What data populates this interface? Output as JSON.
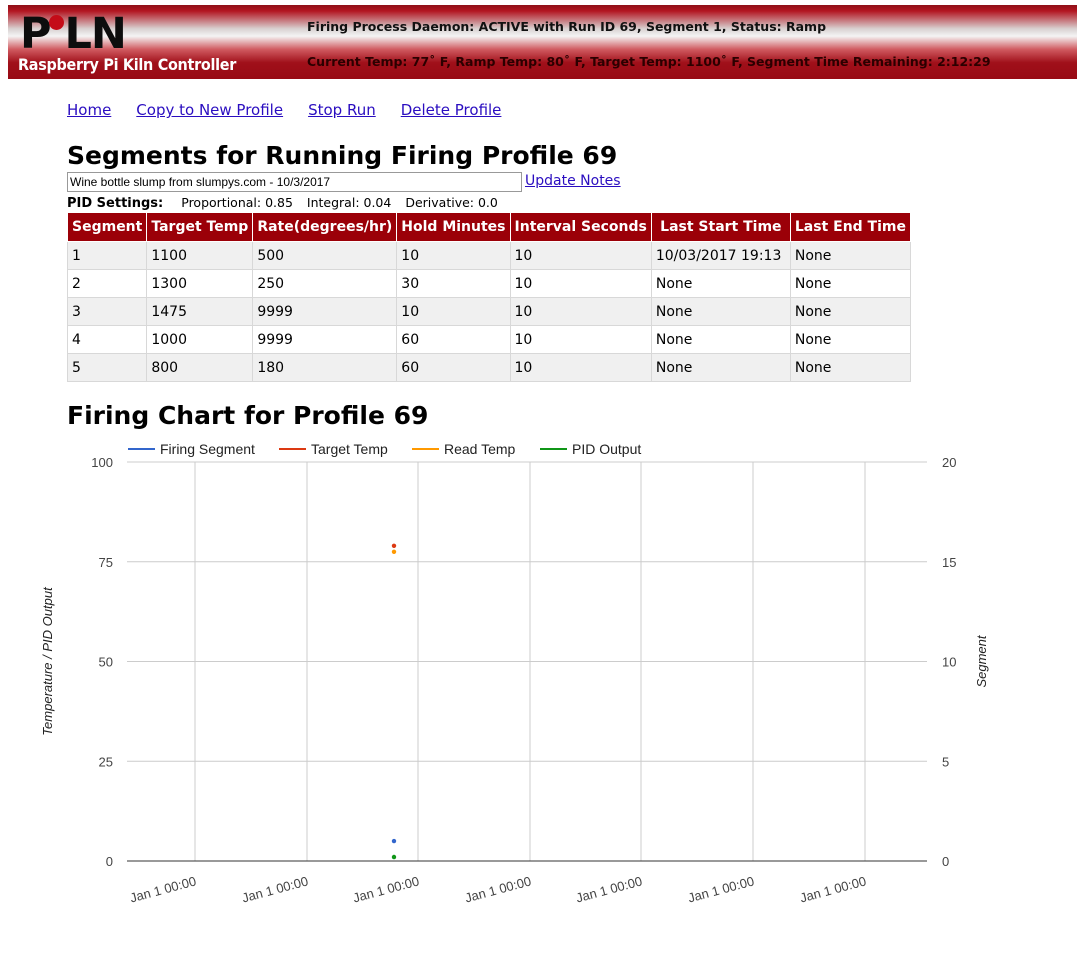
{
  "header": {
    "logo": "PiLN",
    "logo_left": "P",
    "logo_right": "LN",
    "subtitle": "Raspberry Pi Kiln Controller",
    "status_line1": "Firing Process Daemon: ACTIVE with Run ID 69, Segment 1, Status: Ramp",
    "status_line2": "Current Temp: 77˚ F, Ramp Temp: 80˚ F, Target Temp: 1100˚ F, Segment Time Remaining: 2:12:29"
  },
  "nav": {
    "home": "Home",
    "copy": "Copy to New Profile",
    "stop": "Stop Run",
    "delete": "Delete Profile"
  },
  "segments_title": "Segments for Running Firing Profile 69",
  "notes": {
    "value": "Wine bottle slump from slumpys.com - 10/3/2017",
    "update_label": "Update Notes"
  },
  "pid": {
    "label": "PID Settings:",
    "proportional": "Proportional: 0.85",
    "integral": "Integral: 0.04",
    "derivative": "Derivative: 0.0"
  },
  "table": {
    "headers": [
      "Segment",
      "Target Temp",
      "Rate(degrees/hr)",
      "Hold Minutes",
      "Interval Seconds",
      "Last Start Time",
      "Last End Time"
    ],
    "rows": [
      [
        "1",
        "1100",
        "500",
        "10",
        "10",
        "10/03/2017 19:13",
        "None"
      ],
      [
        "2",
        "1300",
        "250",
        "30",
        "10",
        "None",
        "None"
      ],
      [
        "3",
        "1475",
        "9999",
        "10",
        "10",
        "None",
        "None"
      ],
      [
        "4",
        "1000",
        "9999",
        "60",
        "10",
        "None",
        "None"
      ],
      [
        "5",
        "800",
        "180",
        "60",
        "10",
        "None",
        "None"
      ]
    ]
  },
  "chart_title": "Firing Chart for Profile 69",
  "chart_data": {
    "type": "scatter",
    "legend": [
      {
        "name": "Firing Segment",
        "color": "#3366cc"
      },
      {
        "name": "Target Temp",
        "color": "#dc3912"
      },
      {
        "name": "Read Temp",
        "color": "#ff9900"
      },
      {
        "name": "PID Output",
        "color": "#109618"
      }
    ],
    "legend_position": "top",
    "ylabel_left": "Temperature / PID Output",
    "ylabel_right": "Segment",
    "ylim_left": [
      0,
      100
    ],
    "ylim_right": [
      0,
      20
    ],
    "yticks_left": [
      "0",
      "25",
      "50",
      "75",
      "100"
    ],
    "yticks_right": [
      "0",
      "5",
      "10",
      "15",
      "20"
    ],
    "xticks": [
      "Jan 1 00:00",
      "Jan 1 00:00",
      "Jan 1 00:00",
      "Jan 1 00:00",
      "Jan 1 00:00",
      "Jan 1 00:00",
      "Jan 1 00:00"
    ],
    "grid": true,
    "series": [
      {
        "name": "Firing Segment",
        "axis": "right",
        "points": [
          {
            "x": "Jan 1 00:00",
            "y": 1
          }
        ]
      },
      {
        "name": "Target Temp",
        "axis": "left",
        "points": [
          {
            "x": "Jan 1 00:00",
            "y": 79
          }
        ]
      },
      {
        "name": "Read Temp",
        "axis": "left",
        "points": [
          {
            "x": "Jan 1 00:00",
            "y": 77.5
          }
        ]
      },
      {
        "name": "PID Output",
        "axis": "left",
        "points": [
          {
            "x": "Jan 1 00:00",
            "y": 1
          }
        ]
      }
    ]
  }
}
